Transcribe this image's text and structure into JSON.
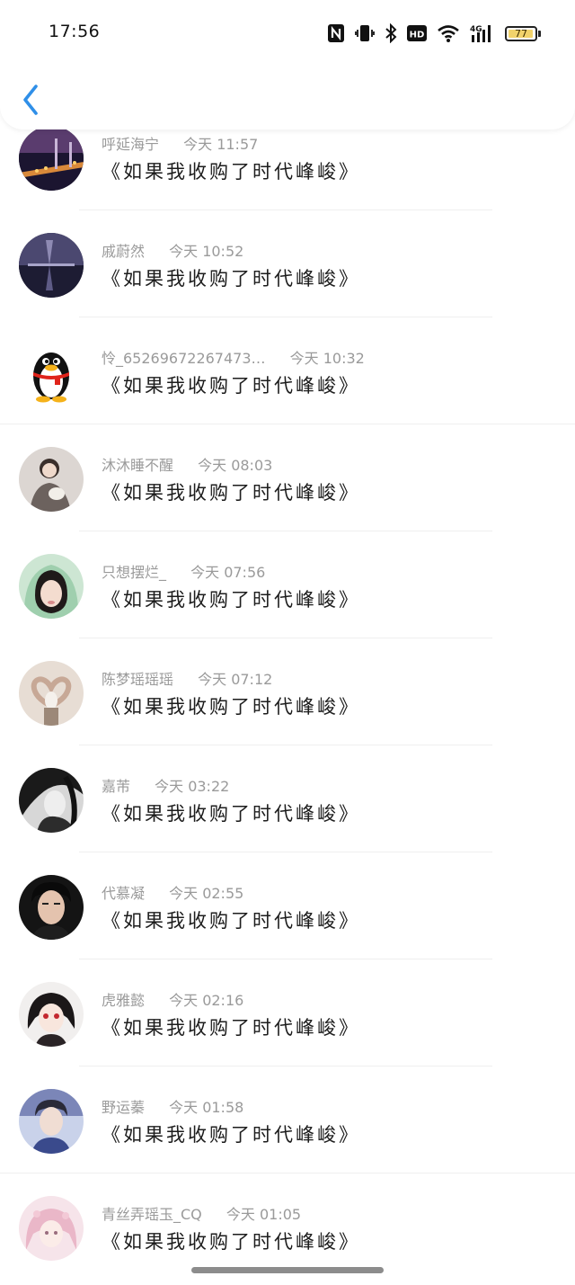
{
  "status_bar": {
    "time": "17:56",
    "icons": [
      "nfc-icon",
      "vibrate-icon",
      "bluetooth-icon",
      "hd-icon",
      "wifi-icon",
      "signal-4g-icon",
      "battery-icon"
    ],
    "hd_label": "HD",
    "network_label": "4G",
    "battery_level": "77"
  },
  "header": {
    "back_icon": "chevron-left-icon",
    "accent_color": "#2f8fe8"
  },
  "messages": [
    {
      "name": "呼延海宁",
      "time": "今天 11:57",
      "text": "《如果我收购了时代峰峻》",
      "avatar": "city-night-bridge"
    },
    {
      "name": "戚蔚然",
      "time": "今天 10:52",
      "text": "《如果我收购了时代峰峻》",
      "avatar": "night-reflection"
    },
    {
      "name": "怜_65269672267473…",
      "time": "今天 10:32",
      "text": "《如果我收购了时代峰峻》",
      "avatar": "qq-penguin"
    },
    {
      "name": "沐沐睡不醒",
      "time": "今天 08:03",
      "text": "《如果我收购了时代峰峻》",
      "avatar": "girl-with-cat"
    },
    {
      "name": "只想摆烂_",
      "time": "今天 07:56",
      "text": "《如果我收购了时代峰峻》",
      "avatar": "girl-green-hood"
    },
    {
      "name": "陈梦瑶瑶瑶",
      "time": "今天 07:12",
      "text": "《如果我收购了时代峰峻》",
      "avatar": "heart-hands"
    },
    {
      "name": "嘉芾",
      "time": "今天 03:22",
      "text": "《如果我收购了时代峰峻》",
      "avatar": "anime-dark-hair"
    },
    {
      "name": "代慕凝",
      "time": "今天 02:55",
      "text": "《如果我收购了时代峰峻》",
      "avatar": "young-man"
    },
    {
      "name": "虎雅懿",
      "time": "今天 02:16",
      "text": "《如果我收购了时代峰峻》",
      "avatar": "anime-girl-red-eyes"
    },
    {
      "name": "野运蓁",
      "time": "今天 01:58",
      "text": "《如果我收购了时代峰峻》",
      "avatar": "young-man-blue"
    },
    {
      "name": "青丝弄瑶玉_CQ",
      "time": "今天 01:05",
      "text": "《如果我收购了时代峰峻》",
      "avatar": "anime-pink-hair"
    }
  ]
}
